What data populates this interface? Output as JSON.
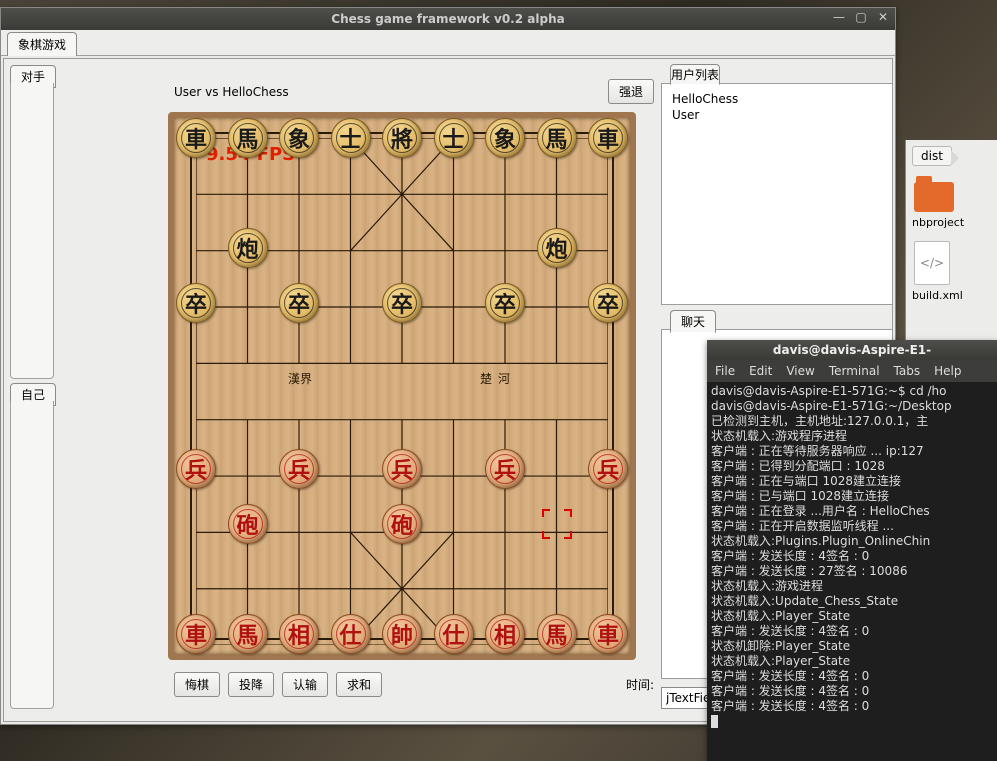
{
  "window": {
    "title": "Chess game framework v0.2 alpha",
    "main_tab": "象棋游戏",
    "opponent_tab": "对手",
    "self_tab": "自己"
  },
  "match": {
    "vs_label": "User vs HelloChess",
    "retreat_btn": "强退",
    "fps": "9.54 FPS",
    "river_left": "漢界",
    "river_right": "楚河",
    "undo": "悔棋",
    "surrender": "投降",
    "admit": "认输",
    "draw": "求和",
    "time_label": "时间:"
  },
  "board": {
    "cols": 9,
    "rows": 10,
    "marker": {
      "col": 7,
      "row": 7
    },
    "pieces": [
      {
        "side": "black",
        "char": "車",
        "col": 0,
        "row": 0
      },
      {
        "side": "black",
        "char": "馬",
        "col": 1,
        "row": 0
      },
      {
        "side": "black",
        "char": "象",
        "col": 2,
        "row": 0
      },
      {
        "side": "black",
        "char": "士",
        "col": 3,
        "row": 0
      },
      {
        "side": "black",
        "char": "將",
        "col": 4,
        "row": 0
      },
      {
        "side": "black",
        "char": "士",
        "col": 5,
        "row": 0
      },
      {
        "side": "black",
        "char": "象",
        "col": 6,
        "row": 0
      },
      {
        "side": "black",
        "char": "馬",
        "col": 7,
        "row": 0
      },
      {
        "side": "black",
        "char": "車",
        "col": 8,
        "row": 0
      },
      {
        "side": "black",
        "char": "炮",
        "col": 1,
        "row": 2
      },
      {
        "side": "black",
        "char": "炮",
        "col": 7,
        "row": 2
      },
      {
        "side": "black",
        "char": "卒",
        "col": 0,
        "row": 3
      },
      {
        "side": "black",
        "char": "卒",
        "col": 2,
        "row": 3
      },
      {
        "side": "black",
        "char": "卒",
        "col": 4,
        "row": 3
      },
      {
        "side": "black",
        "char": "卒",
        "col": 6,
        "row": 3
      },
      {
        "side": "black",
        "char": "卒",
        "col": 8,
        "row": 3
      },
      {
        "side": "red",
        "char": "兵",
        "col": 0,
        "row": 6
      },
      {
        "side": "red",
        "char": "兵",
        "col": 2,
        "row": 6
      },
      {
        "side": "red",
        "char": "兵",
        "col": 4,
        "row": 6
      },
      {
        "side": "red",
        "char": "兵",
        "col": 6,
        "row": 6
      },
      {
        "side": "red",
        "char": "兵",
        "col": 8,
        "row": 6
      },
      {
        "side": "red",
        "char": "砲",
        "col": 1,
        "row": 7
      },
      {
        "side": "red",
        "char": "砲",
        "col": 4,
        "row": 7
      },
      {
        "side": "red",
        "char": "車",
        "col": 0,
        "row": 9
      },
      {
        "side": "red",
        "char": "馬",
        "col": 1,
        "row": 9
      },
      {
        "side": "red",
        "char": "相",
        "col": 2,
        "row": 9
      },
      {
        "side": "red",
        "char": "仕",
        "col": 3,
        "row": 9
      },
      {
        "side": "red",
        "char": "帥",
        "col": 4,
        "row": 9
      },
      {
        "side": "red",
        "char": "仕",
        "col": 5,
        "row": 9
      },
      {
        "side": "red",
        "char": "相",
        "col": 6,
        "row": 9
      },
      {
        "side": "red",
        "char": "馬",
        "col": 7,
        "row": 9
      },
      {
        "side": "red",
        "char": "車",
        "col": 8,
        "row": 9
      }
    ]
  },
  "right": {
    "userlist_tab": "用户列表",
    "users": [
      "HelloChess",
      "User"
    ],
    "chat_tab": "聊天",
    "jtext_value": "jTextFiel"
  },
  "filemgr": {
    "crumb": "dist",
    "folder": "nbproject",
    "file": "build.xml",
    "file_glyph": "</>"
  },
  "terminal": {
    "title": "davis@davis-Aspire-E1-",
    "menus": [
      "File",
      "Edit",
      "View",
      "Terminal",
      "Tabs",
      "Help"
    ],
    "lines": [
      "davis@davis-Aspire-E1-571G:~$ cd /ho",
      "davis@davis-Aspire-E1-571G:~/Desktop",
      "已检测到主机，主机地址:127.0.0.1，主",
      "状态机载入:游戏程序进程",
      "客户端 : 正在等待服务器响应 ... ip:127",
      "客户端 : 已得到分配端口 : 1028",
      "客户端 : 正在与端口 1028建立连接",
      "客户端 : 已与端口 1028建立连接",
      "客户端 : 正在登录 ...用户名 : HelloChes",
      "客户端 : 正在开启数据监听线程 ...",
      "状态机载入:Plugins.Plugin_OnlineChin",
      "客户端 : 发送长度 : 4签名 : 0",
      "客户端 : 发送长度 : 27签名 : 10086",
      "状态机载入:游戏进程",
      "状态机载入:Update_Chess_State",
      "状态机载入:Player_State",
      "客户端 : 发送长度 : 4签名 : 0",
      "状态机卸除:Player_State",
      "状态机载入:Player_State",
      "客户端 : 发送长度 : 4签名 : 0",
      "客户端 : 发送长度 : 4签名 : 0",
      "客户端 : 发送长度 : 4签名 : 0"
    ]
  }
}
